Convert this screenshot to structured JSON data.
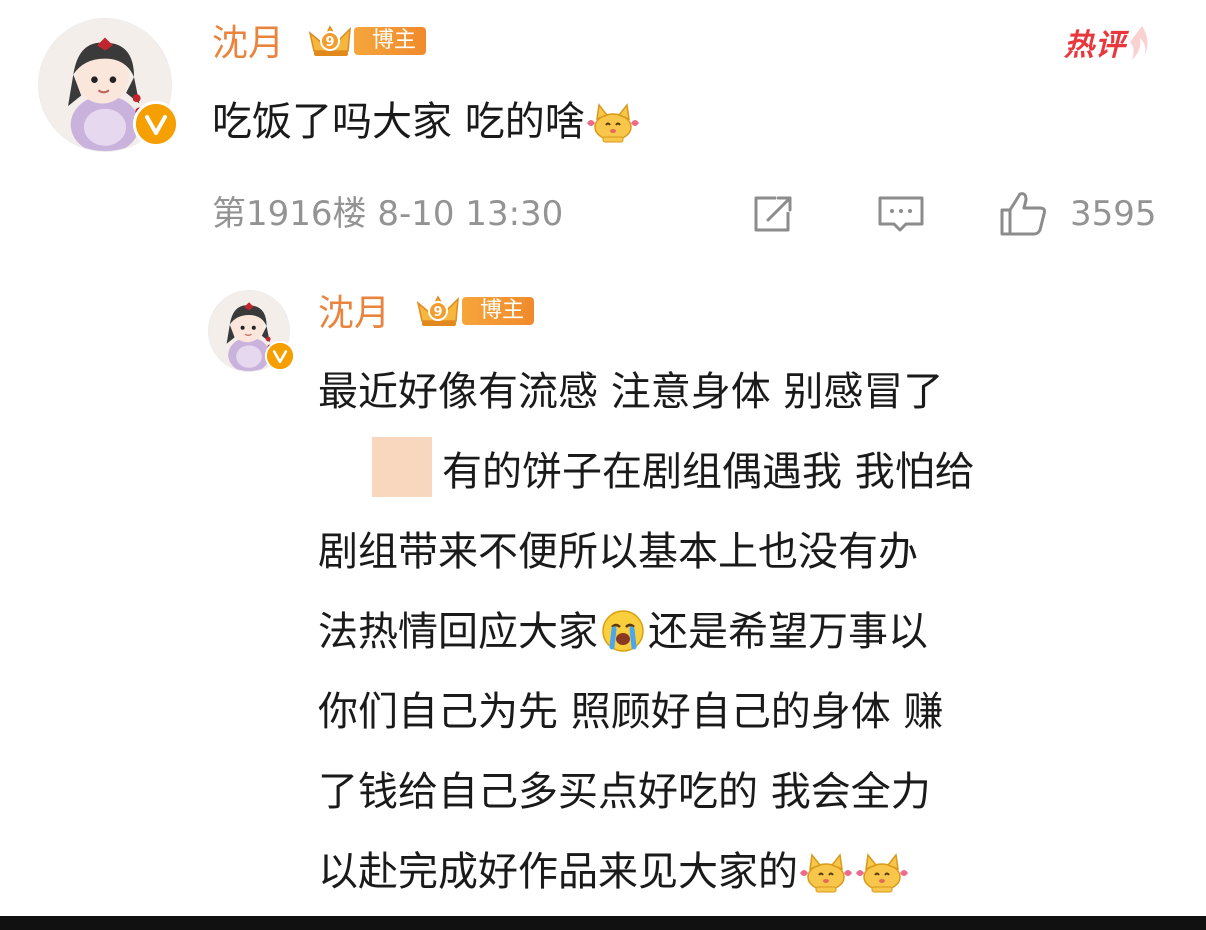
{
  "comment": {
    "username": "沈月",
    "badge_label": "博主",
    "hot_label": "热评",
    "text": "吃饭了吗大家 吃的啥",
    "emoji": "cat-emoji",
    "meta": "第1916楼 8-10 13:30",
    "actions": {
      "share_icon": "share-icon",
      "comment_icon": "comment-icon",
      "like_icon": "like-icon",
      "like_count": "3595"
    }
  },
  "reply": {
    "username": "沈月",
    "badge_label": "博主",
    "lines": [
      "最近好像有流感 注意身体 别感冒了",
      "有的饼子在剧组偶遇我 我怕给",
      "剧组带来不便所以基本上也没有办",
      "法热情回应大家",
      "还是希望万事以",
      "你们自己为先 照顾好自己的身体 赚",
      "了钱给自己多买点好吃的  我会全力",
      "以赴完成好作品来见大家的"
    ]
  },
  "colors": {
    "username": "#e8843e",
    "hot": "#e8383d",
    "meta": "#939393",
    "verified": "#f5a000"
  }
}
